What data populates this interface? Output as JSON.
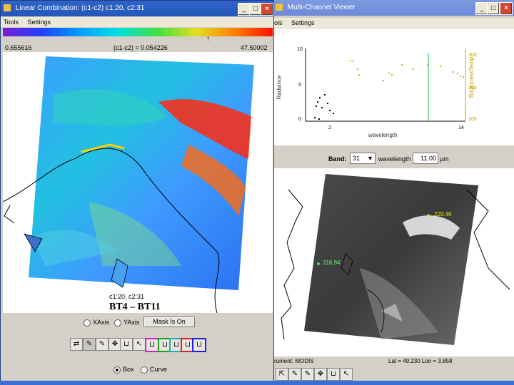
{
  "left_window": {
    "title": "Linear Combination: (c1-c2)  c1:20,  c2:31",
    "menu": [
      "Tools",
      "Settings"
    ],
    "scale_min": "0.655616",
    "scale_center": "(c1-c2) = 0.054226",
    "scale_max": "47.50002",
    "channels_label": "c1:20,  c2:31",
    "image_caption": "BT4 – BT11",
    "radio_xaxis": "XAxis",
    "radio_yaxis": "YAxis",
    "mask_button": "Mask Is On",
    "radio_box": "Box",
    "radio_curve": "Curve"
  },
  "right_window": {
    "title": "Multi-Channel Viewer",
    "menu": [
      "ols",
      "Settings"
    ],
    "band_label": "Band:",
    "band_value": "31",
    "wavelength_label": "wavelength",
    "wavelength_value": "11.00",
    "wavelength_unit": "µm",
    "plot": {
      "ylabel_left": "Radiance",
      "ylabel_right": "BrightnessTemp",
      "xlabel": "wavelength",
      "y_ticks_left": [
        "10",
        "5",
        "0"
      ],
      "y_ticks_right": [
        "300",
        "200",
        "100"
      ],
      "x_ticks": [
        "2",
        "14"
      ]
    },
    "marker_1": "229.46",
    "marker_2": "316.94",
    "status_instrument": "rument: MODIS",
    "status_latlon": "Lat = 49.230   Lon = 3.858"
  },
  "colors": {
    "titlebar": "#2457b8",
    "menu_bg": "#ece9d8",
    "taskbar": "#3a6fd8"
  }
}
